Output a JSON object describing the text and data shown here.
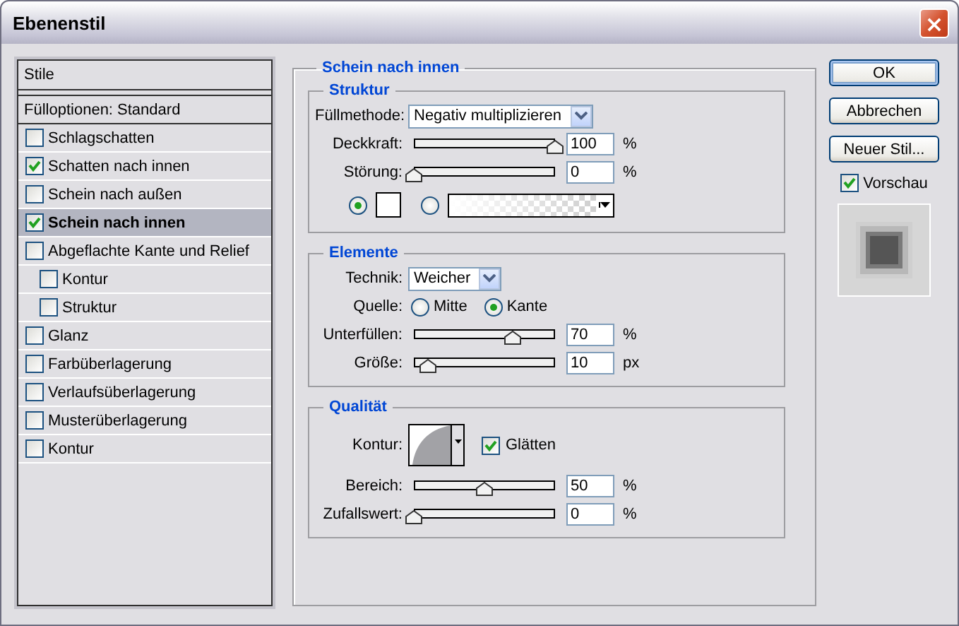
{
  "window": {
    "title": "Ebenenstil"
  },
  "styles_list": {
    "header": "Stile",
    "items": [
      {
        "kind": "plain",
        "label": "Fülloptionen: Standard",
        "selected": false
      },
      {
        "kind": "checkbox",
        "label": "Schlagschatten",
        "checked": false,
        "selected": false
      },
      {
        "kind": "checkbox",
        "label": "Schatten nach innen",
        "checked": true,
        "selected": false
      },
      {
        "kind": "checkbox",
        "label": "Schein nach außen",
        "checked": false,
        "selected": false
      },
      {
        "kind": "checkbox",
        "label": "Schein nach innen",
        "checked": true,
        "selected": true
      },
      {
        "kind": "checkbox",
        "label": "Abgeflachte Kante und Relief",
        "checked": false,
        "selected": false,
        "children": [
          {
            "kind": "checkbox",
            "label": "Kontur",
            "checked": false,
            "selected": false
          },
          {
            "kind": "checkbox",
            "label": "Struktur",
            "checked": false,
            "selected": false
          }
        ]
      },
      {
        "kind": "checkbox",
        "label": "Glanz",
        "checked": false,
        "selected": false
      },
      {
        "kind": "checkbox",
        "label": "Farbüberlagerung",
        "checked": false,
        "selected": false
      },
      {
        "kind": "checkbox",
        "label": "Verlaufsüberlagerung",
        "checked": false,
        "selected": false
      },
      {
        "kind": "checkbox",
        "label": "Musterüberlagerung",
        "checked": false,
        "selected": false
      },
      {
        "kind": "checkbox",
        "label": "Kontur",
        "checked": false,
        "selected": false
      }
    ]
  },
  "panel": {
    "title": "Schein nach innen",
    "groups": [
      {
        "title": "Struktur",
        "rows": [
          {
            "kind": "select",
            "label": "Füllmethode:",
            "value": "Negativ multiplizieren"
          },
          {
            "kind": "slider",
            "label": "Deckkraft:",
            "level": 1,
            "value": "100",
            "unit": "%"
          },
          {
            "kind": "slider",
            "label": "Störung:",
            "level": 0,
            "value": "0",
            "unit": "%"
          },
          {
            "kind": "fill",
            "options": [
              {
                "kind": "color",
                "selected": true
              },
              {
                "kind": "gradient",
                "selected": false
              }
            ]
          }
        ]
      },
      {
        "title": "Elemente",
        "rows": [
          {
            "kind": "select",
            "label": "Technik:",
            "value": "Weicher"
          },
          {
            "kind": "radio",
            "label": "Quelle:",
            "options": [
              {
                "label": "Mitte",
                "selected": false
              },
              {
                "label": "Kante",
                "selected": true
              }
            ]
          },
          {
            "kind": "slider",
            "label": "Unterfüllen:",
            "level": 0.7,
            "value": "70",
            "unit": "%"
          },
          {
            "kind": "slider",
            "label": "Größe:",
            "level": 0.1,
            "value": "10",
            "unit": "px"
          }
        ]
      },
      {
        "title": "Qualität",
        "rows": [
          {
            "kind": "contour",
            "label": "Kontur:",
            "check_label": "Glätten",
            "checked": true
          },
          {
            "kind": "slider",
            "label": "Bereich:",
            "level": 0.5,
            "value": "50",
            "unit": "%"
          },
          {
            "kind": "slider",
            "label": "Zufallswert:",
            "level": 0,
            "value": "0",
            "unit": "%"
          }
        ]
      }
    ]
  },
  "buttons": [
    {
      "label": "OK",
      "default": true
    },
    {
      "label": "Abbrechen",
      "default": false
    },
    {
      "label": "Neuer Stil...",
      "default": false
    }
  ],
  "preview": {
    "label": "Vorschau",
    "checked": true
  }
}
